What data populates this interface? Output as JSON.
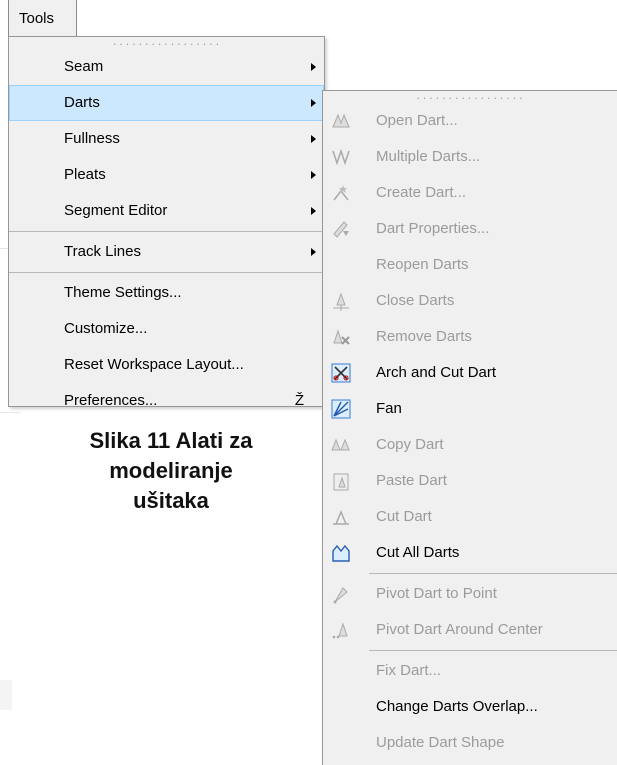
{
  "menubar": {
    "tools_label": "Tools"
  },
  "tools_menu": {
    "items": [
      {
        "label": "Seam",
        "has_submenu": true
      },
      {
        "label": "Darts",
        "has_submenu": true,
        "selected": true
      },
      {
        "label": "Fullness",
        "has_submenu": true
      },
      {
        "label": "Pleats",
        "has_submenu": true
      },
      {
        "label": "Segment Editor",
        "has_submenu": true
      },
      {
        "label": "Track Lines",
        "has_submenu": true
      },
      {
        "label": "Theme Settings..."
      },
      {
        "label": "Customize..."
      },
      {
        "label": "Reset Workspace Layout..."
      },
      {
        "label": "Preferences...",
        "shortcut": "Ž"
      }
    ]
  },
  "darts_menu": {
    "items": [
      {
        "label": "Open Dart...",
        "icon": "open-dart-icon",
        "enabled": false
      },
      {
        "label": "Multiple Darts...",
        "icon": "multiple-darts-icon",
        "enabled": false
      },
      {
        "label": "Create Dart...",
        "icon": "create-dart-icon",
        "enabled": false
      },
      {
        "label": "Dart Properties...",
        "icon": "dart-properties-icon",
        "enabled": false
      },
      {
        "label": "Reopen Darts",
        "enabled": false
      },
      {
        "label": "Close Darts",
        "icon": "close-darts-icon",
        "enabled": false
      },
      {
        "label": "Remove Darts",
        "icon": "remove-darts-icon",
        "enabled": false
      },
      {
        "label": "Arch and Cut Dart",
        "icon": "arch-cut-dart-icon",
        "enabled": true
      },
      {
        "label": "Fan",
        "icon": "fan-icon",
        "enabled": true
      },
      {
        "label": "Copy Dart",
        "icon": "copy-dart-icon",
        "enabled": false
      },
      {
        "label": "Paste Dart",
        "icon": "paste-dart-icon",
        "enabled": false
      },
      {
        "label": "Cut Dart",
        "icon": "cut-dart-icon",
        "enabled": false
      },
      {
        "label": "Cut All Darts",
        "icon": "cut-all-darts-icon",
        "enabled": true
      },
      {
        "label": "Pivot Dart to Point",
        "icon": "pivot-dart-point-icon",
        "enabled": false
      },
      {
        "label": "Pivot Dart Around Center",
        "icon": "pivot-dart-center-icon",
        "enabled": false
      },
      {
        "label": "Fix Dart...",
        "enabled": false
      },
      {
        "label": "Change Darts Overlap...",
        "enabled": true
      },
      {
        "label": "Update Dart Shape",
        "enabled": false
      }
    ]
  },
  "caption": {
    "line1": "Slika 11 Alati za",
    "line2": "modeliranje",
    "line3": "ušitaka"
  }
}
